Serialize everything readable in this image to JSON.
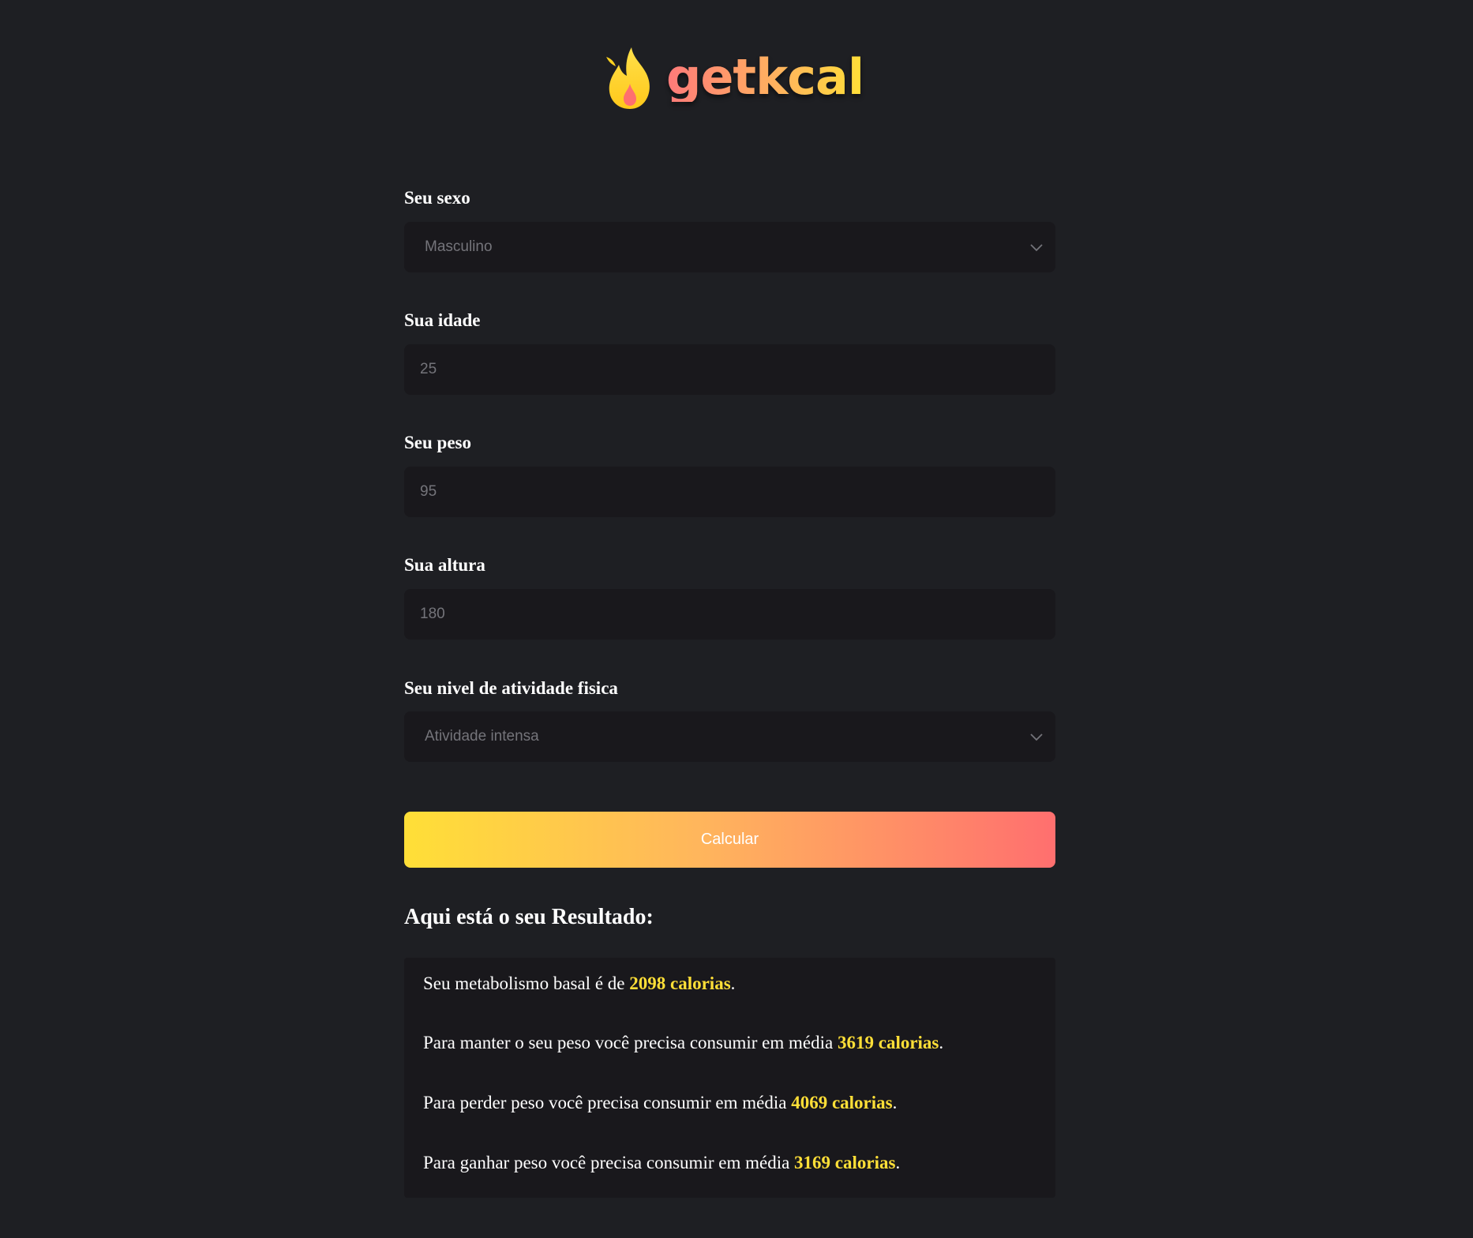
{
  "brand": {
    "name": "getkcal",
    "logo_icon": "flame-icon",
    "gradient": [
      "#ff7a7a",
      "#ffb65c",
      "#ffdf37"
    ]
  },
  "form": {
    "sex": {
      "label": "Seu sexo",
      "value": "Masculino",
      "icon": "chevron-down-icon"
    },
    "age": {
      "label": "Sua idade",
      "placeholder": "25"
    },
    "weight": {
      "label": "Seu peso",
      "placeholder": "95"
    },
    "height": {
      "label": "Sua altura",
      "placeholder": "180"
    },
    "activity": {
      "label": "Seu nivel de atividade fisica",
      "value": "Atividade intensa",
      "icon": "chevron-down-icon"
    },
    "submit_label": "Calcular"
  },
  "result": {
    "title": "Aqui está o seu Resultado:",
    "lines": [
      {
        "prefix": "Seu metabolismo basal é de ",
        "value": "2098 calorias",
        "suffix": "."
      },
      {
        "prefix": "Para manter o seu peso você precisa consumir em média ",
        "value": "3619 calorias",
        "suffix": "."
      },
      {
        "prefix": "Para perder peso você precisa consumir em média ",
        "value": "4069 calorias",
        "suffix": "."
      },
      {
        "prefix": "Para ganhar peso você precisa consumir em média ",
        "value": "3169 calorias",
        "suffix": "."
      }
    ]
  },
  "colors": {
    "background": "#1e1f23",
    "field_background": "#19181c",
    "highlight": "#ffdf37",
    "button_gradient": [
      "#ffdf37",
      "#ffb65c",
      "#ff6f6f"
    ]
  }
}
